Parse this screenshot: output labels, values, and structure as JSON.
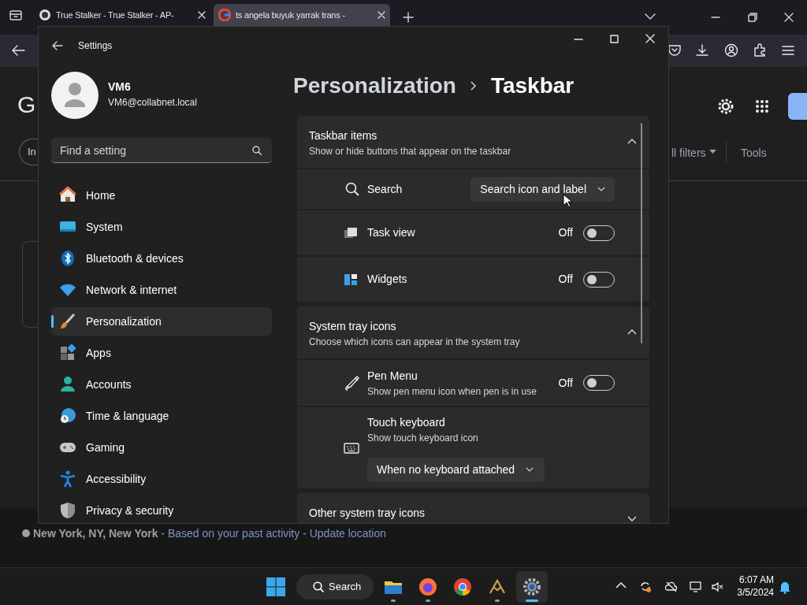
{
  "browser": {
    "tabs": [
      {
        "title": "True Stalker - True Stalker - AP-",
        "selected": false
      },
      {
        "title": "ts angela buyuk yarrak trans -",
        "selected": true
      }
    ],
    "page": {
      "logo": "G",
      "chip": "In",
      "filters": "ll filters",
      "tools": "Tools",
      "location": [
        {
          "kind": "place",
          "text": "New York, NY, New York"
        },
        {
          "kind": "plain",
          "text": " - "
        },
        {
          "kind": "link",
          "text": "Based on your past activity"
        },
        {
          "kind": "plain",
          "text": " - "
        },
        {
          "kind": "link",
          "text": "Update location"
        }
      ]
    }
  },
  "settings": {
    "title": "Settings",
    "user": {
      "name": "VM6",
      "email": "VM6@collabnet.local"
    },
    "search_placeholder": "Find a setting",
    "nav": [
      {
        "label": "Home",
        "selected": false
      },
      {
        "label": "System",
        "selected": false
      },
      {
        "label": "Bluetooth & devices",
        "selected": false
      },
      {
        "label": "Network & internet",
        "selected": false
      },
      {
        "label": "Personalization",
        "selected": true
      },
      {
        "label": "Apps",
        "selected": false
      },
      {
        "label": "Accounts",
        "selected": false
      },
      {
        "label": "Time & language",
        "selected": false
      },
      {
        "label": "Gaming",
        "selected": false
      },
      {
        "label": "Accessibility",
        "selected": false
      },
      {
        "label": "Privacy & security",
        "selected": false
      }
    ],
    "breadcrumb": [
      "Personalization",
      "Taskbar"
    ],
    "sections": [
      {
        "title": "Taskbar items",
        "subtitle": "Show or hide buttons that appear on the taskbar",
        "expanded": true,
        "items": [
          {
            "kind": "select",
            "label": "Search",
            "value": "Search icon and label"
          },
          {
            "kind": "toggle",
            "label": "Task view",
            "state_text": "Off",
            "on": false
          },
          {
            "kind": "toggle",
            "label": "Widgets",
            "state_text": "Off",
            "on": false
          }
        ]
      },
      {
        "title": "System tray icons",
        "subtitle": "Choose which icons can appear in the system tray",
        "expanded": true,
        "items": [
          {
            "kind": "toggle",
            "label": "Pen Menu",
            "description": "Show pen menu icon when pen is in use",
            "state_text": "Off",
            "on": false
          },
          {
            "kind": "select_below",
            "label": "Touch keyboard",
            "description": "Show touch keyboard icon",
            "value": "When no keyboard attached"
          }
        ]
      },
      {
        "title": "Other system tray icons",
        "expanded": false
      }
    ]
  },
  "taskbar": {
    "search_label": "Search",
    "apps": [
      {
        "running": true,
        "active": false
      },
      {
        "running": true,
        "active": false
      },
      {
        "running": false,
        "active": false
      },
      {
        "running": true,
        "active": false
      },
      {
        "running": true,
        "active": true
      }
    ],
    "clock": {
      "time": "6:07 AM",
      "date": "3/5/2024"
    }
  }
}
